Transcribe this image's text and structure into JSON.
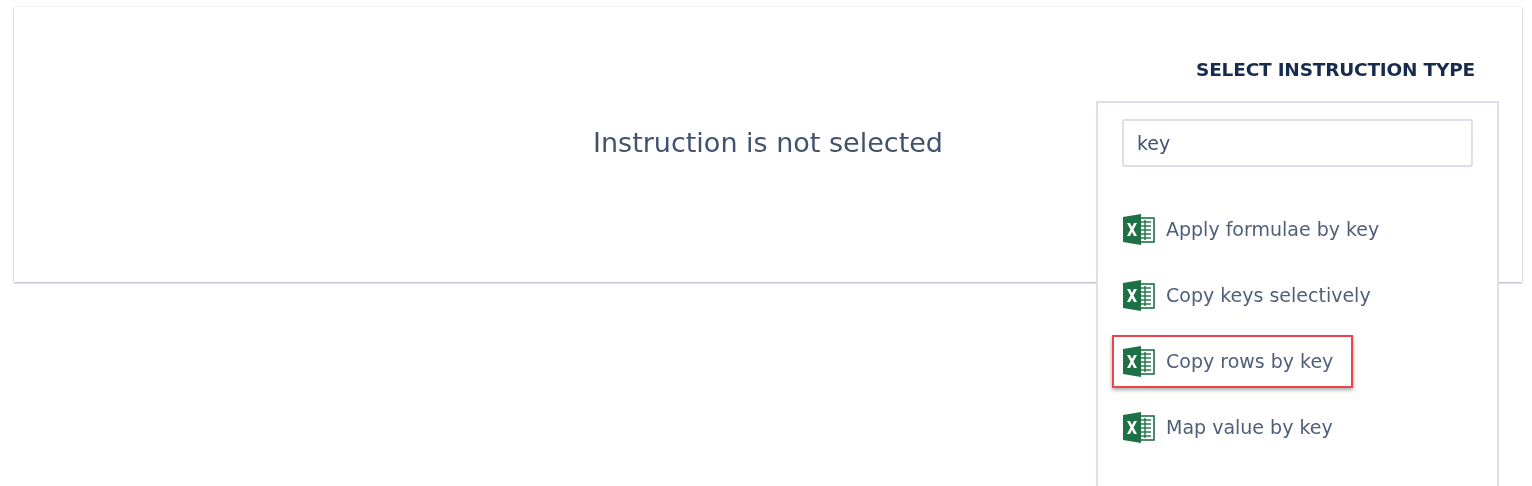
{
  "panel": {
    "message": "Instruction is not selected"
  },
  "instruction_type": {
    "heading": "SELECT INSTRUCTION TYPE",
    "search": {
      "value": "key"
    },
    "options": [
      {
        "label": "Apply formulae by key",
        "selected": false
      },
      {
        "label": "Copy keys selectively",
        "selected": false
      },
      {
        "label": "Copy rows by key",
        "selected": true
      },
      {
        "label": "Map value by key",
        "selected": false
      }
    ]
  }
}
